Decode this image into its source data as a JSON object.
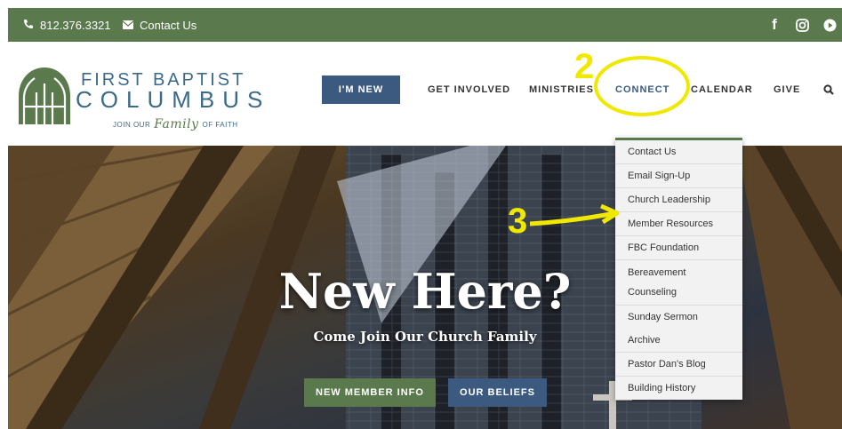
{
  "topbar": {
    "phone": "812.376.3321",
    "contact": "Contact Us",
    "social": [
      "facebook-icon",
      "instagram-icon",
      "youtube-icon"
    ]
  },
  "logo": {
    "line1": "FIRST BAPTIST",
    "line2": "COLUMBUS",
    "tag_pre": "JOIN OUR",
    "tag_script": "Family",
    "tag_post": "OF FAITH"
  },
  "nav": {
    "new": "I'M NEW",
    "involved": "GET INVOLVED",
    "ministries": "MINISTRIES",
    "connect": "CONNECT",
    "calendar": "CALENDAR",
    "give": "GIVE"
  },
  "dropdown": [
    "Contact Us",
    "Email Sign-Up",
    "Church Leadership",
    "Member Resources",
    "FBC Foundation",
    "Bereavement Counseling",
    "Sunday Sermon Archive",
    "Pastor Dan's Blog",
    "Building History"
  ],
  "hero": {
    "title": "New Here?",
    "subtitle": "Come Join Our Church Family",
    "btn_info": "NEW MEMBER INFO",
    "btn_beliefs": "OUR BELIEFS"
  },
  "annotations": {
    "label_2": "2",
    "label_3": "3",
    "color": "#f1e800"
  },
  "colors": {
    "green": "#5a7a4e",
    "blue": "#3c5a80"
  }
}
